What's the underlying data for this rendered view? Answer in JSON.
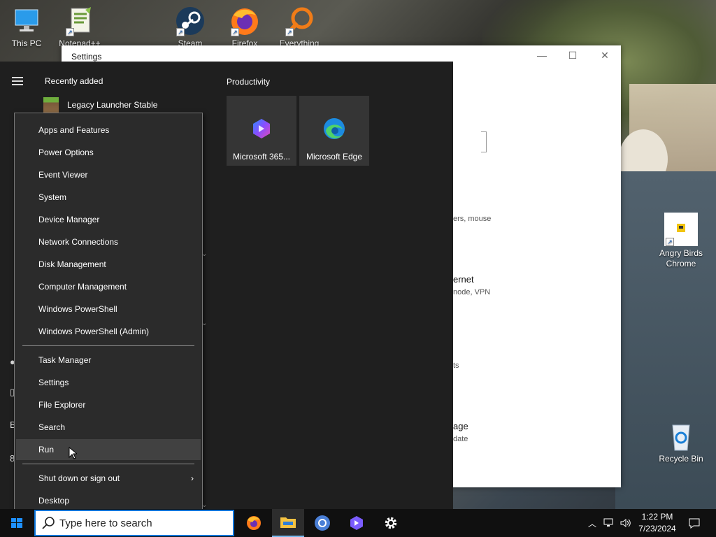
{
  "desktop": {
    "icons": [
      {
        "label": "This PC"
      },
      {
        "label": "Notepad++"
      },
      {
        "label": "Steam"
      },
      {
        "label": "Firefox"
      },
      {
        "label": "Everything"
      },
      {
        "label": "Angry Birds Chrome"
      },
      {
        "label": "Recycle Bin"
      }
    ]
  },
  "settings_window": {
    "title": "Settings",
    "fragments": [
      "ers, mouse",
      "ernet",
      "node, VPN",
      "ts",
      "age",
      "date"
    ]
  },
  "start_menu": {
    "recently_added_title": "Recently added",
    "recent_item": "Legacy Launcher Stable",
    "productivity_title": "Productivity",
    "tiles": [
      {
        "label": "Microsoft 365...",
        "icon": "microsoft-365-icon"
      },
      {
        "label": "Microsoft Edge",
        "icon": "edge-icon"
      }
    ],
    "side_glyphs": [
      "B",
      "8"
    ]
  },
  "context_menu": {
    "group1": [
      "Apps and Features",
      "Power Options",
      "Event Viewer",
      "System",
      "Device Manager",
      "Network Connections",
      "Disk Management",
      "Computer Management",
      "Windows PowerShell",
      "Windows PowerShell (Admin)"
    ],
    "group2": [
      "Task Manager",
      "Settings",
      "File Explorer",
      "Search",
      "Run"
    ],
    "group3": [
      "Shut down or sign out",
      "Desktop"
    ],
    "hovered_item": "Run"
  },
  "taskbar": {
    "search_placeholder": "Type here to search",
    "apps": [
      "firefox-icon",
      "file-explorer-icon",
      "chrome-icon",
      "microsoft-365-icon",
      "settings-gear-icon"
    ],
    "clock": {
      "time": "1:22 PM",
      "date": "7/23/2024"
    }
  }
}
